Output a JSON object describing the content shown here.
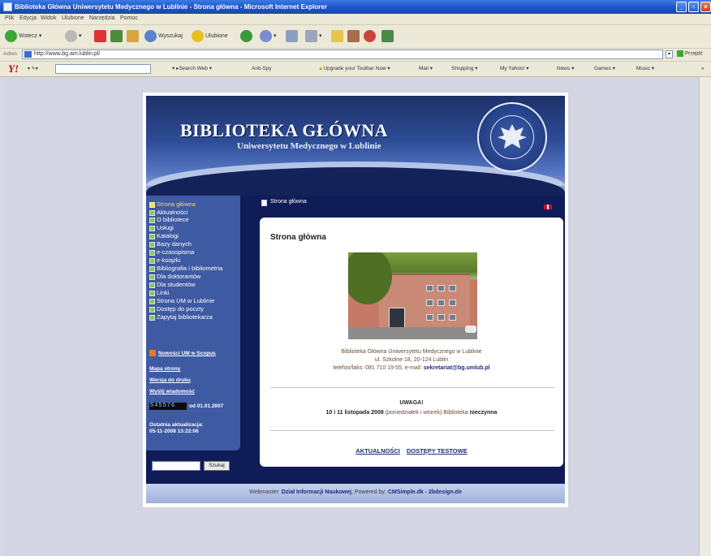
{
  "window": {
    "title": "Biblioteka Główna Uniwersytetu Medycznego w Lublinie - Strona główna - Microsoft Internet Explorer"
  },
  "menu": [
    "Plik",
    "Edycja",
    "Widok",
    "Ulubione",
    "Narzędzia",
    "Pomoc"
  ],
  "toolbar": {
    "back": "Wstecz",
    "search": "Wyszukaj",
    "favorites": "Ulubione"
  },
  "address": {
    "label": "Adres",
    "url": "http://www.bg.am.lublin.pl/",
    "go": "Przejdź"
  },
  "yahoo_toolbar": {
    "logo": "Y!",
    "items": [
      "Search Web",
      "Anti-Spy",
      "Upgrade your Toolbar Now",
      "Mail",
      "Shopping",
      "My Yahoo!",
      "News",
      "Games",
      "Music"
    ]
  },
  "site": {
    "header_title": "BIBLIOTEKA GŁÓWNA",
    "header_subtitle": "Uniwersytetu Medycznego w Lublinie",
    "nav": [
      "Strona główna",
      "Aktualności",
      "O bibliotece",
      "Usługi",
      "Katalogi",
      "Bazy danych",
      "e-czasopisma",
      "e-książki",
      "Bibliografia i bibliometria",
      "Dla doktorantów",
      "Dla studentów",
      "Linki",
      "Strona UM w Lublinie",
      "Dostęp do poczty",
      "Zapytaj bibliotekarza"
    ],
    "rss_label": "Nowości UM w Scopus",
    "side_links": [
      "Mapa strony",
      "Wersja do druku",
      "Wyślij wiadomość"
    ],
    "counter": "545576",
    "counter_since": "od 01.01.2007",
    "last_update_label": "Ostatnia aktualizacja:",
    "last_update": "05-11-2008 13:22:06",
    "search_button": "Szukaj",
    "breadcrumb": "Strona główna",
    "page_title": "Strona główna",
    "address_line1": "Biblioteka Główna Uniwersytetu Medycznego w Lublinie",
    "address_line2": "ul. Szkolne 18, 20-124 Lublin",
    "address_line3": "telefon/faks: 081 710 19 55, e-mail:",
    "email": "sekretariat@bg.umlub.pl",
    "notice_title": "UWAGA!",
    "notice_date": "10 i 11 listopada 2008",
    "notice_days": "(poniedziałek i wtorek)",
    "notice_mid": "Biblioteka",
    "notice_status": "nieczynna",
    "bottom_links": [
      "AKTUALNOŚCI",
      "DOSTĘPY TESTOWE"
    ],
    "footer_prefix": "Webmaster:",
    "footer_webmaster": "Dział Informacji Naukowej",
    "footer_powered": "; Powered by:",
    "footer_cms": "CMSimple.dk - 2bdesign.de"
  }
}
